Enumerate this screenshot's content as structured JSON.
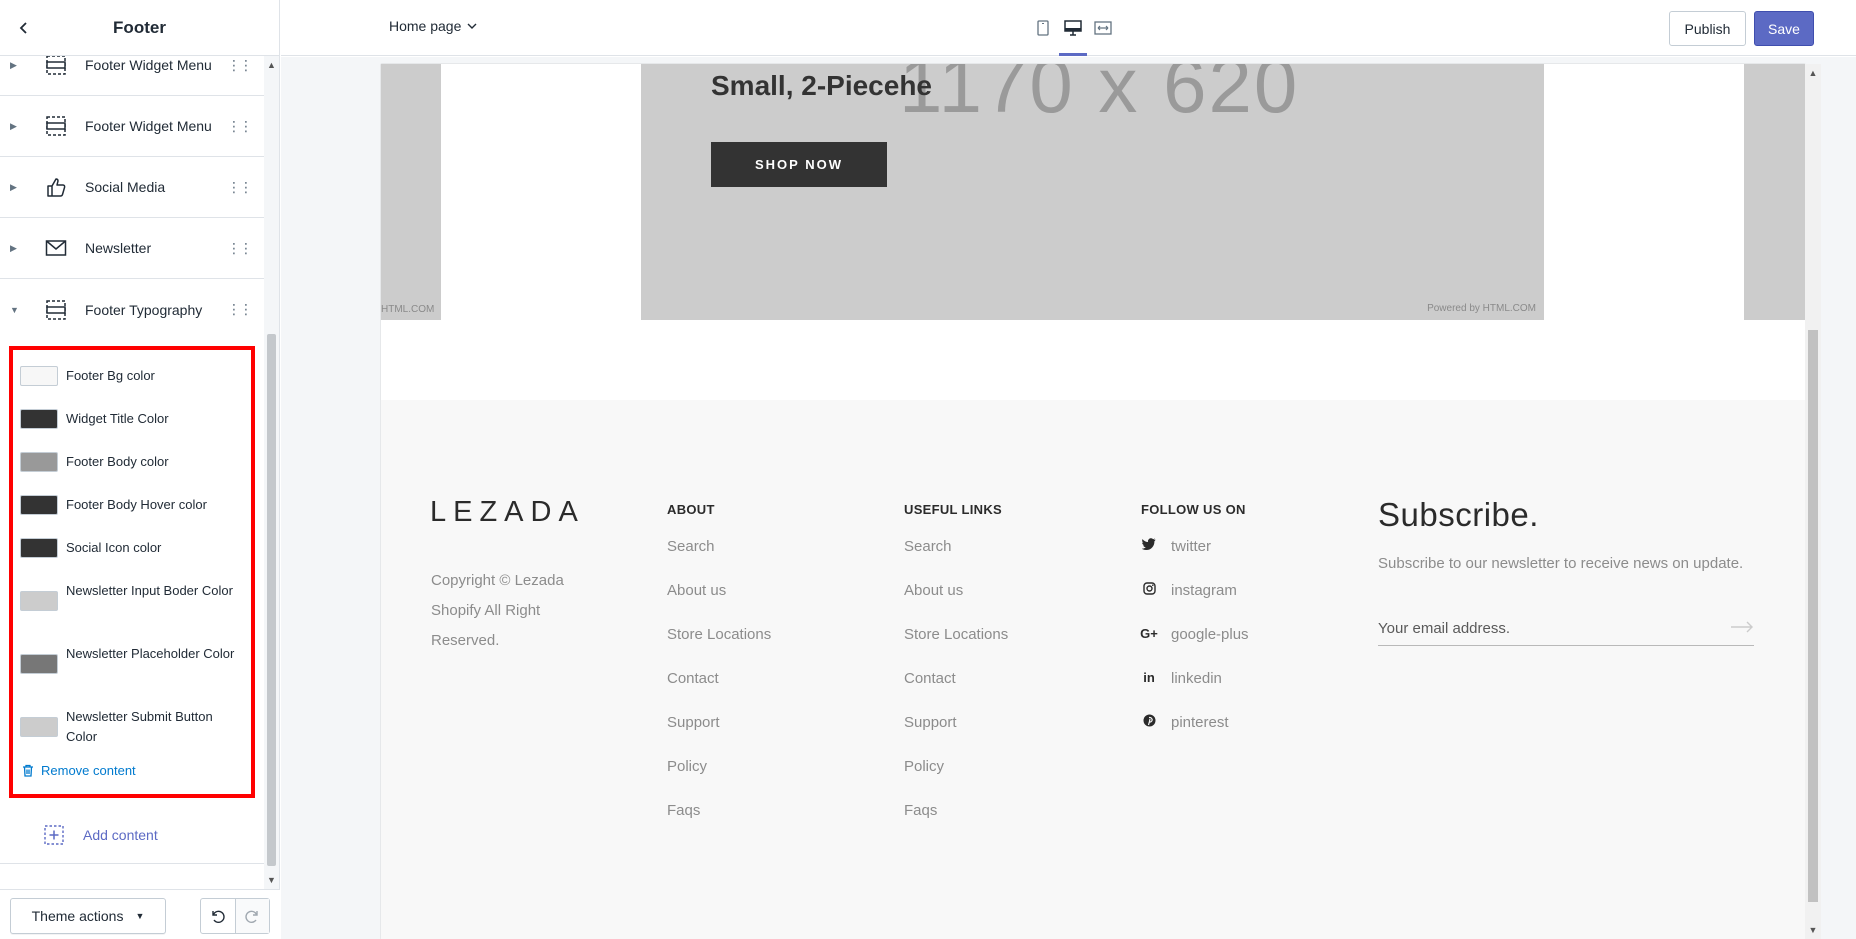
{
  "sidebar": {
    "title": "Footer",
    "sections": [
      {
        "label": "Footer Widget Menu",
        "icon": "widget-menu-icon"
      },
      {
        "label": "Footer Widget Menu",
        "icon": "widget-menu-icon"
      },
      {
        "label": "Social Media",
        "icon": "thumbs-up-icon"
      },
      {
        "label": "Newsletter",
        "icon": "envelope-icon"
      },
      {
        "label": "Footer Typography",
        "icon": "widget-menu-icon",
        "expanded": true
      }
    ],
    "color_settings": [
      {
        "label": "Footer Bg color",
        "color": "#f7f7f7"
      },
      {
        "label": "Widget Title Color",
        "color": "#333333"
      },
      {
        "label": "Footer Body color",
        "color": "#999999"
      },
      {
        "label": "Footer Body Hover color",
        "color": "#333333"
      },
      {
        "label": "Social Icon color",
        "color": "#333333"
      },
      {
        "label": "Newsletter Input Boder Color",
        "color": "#cccccc"
      },
      {
        "label": "Newsletter Placeholder Color",
        "color": "#777777"
      },
      {
        "label": "Newsletter Submit Button Color",
        "color": "#cccccc"
      }
    ],
    "remove_label": "Remove content",
    "add_label": "Add content",
    "theme_actions_label": "Theme actions"
  },
  "topbar": {
    "page_selector": "Home page",
    "publish_label": "Publish",
    "save_label": "Save",
    "accent": "#5c6ac4"
  },
  "preview": {
    "hero": {
      "heading": "Small, 2-Piecehe",
      "placeholder_size": "1170 x 620",
      "button": "SHOP NOW",
      "powered": "Powered by HTML.COM",
      "powered_left": "HTML.COM"
    },
    "footer": {
      "logo": "LEZADA",
      "copyright": "Copyright © Lezada Shopify All Right Reserved.",
      "about": {
        "heading": "ABOUT",
        "links": [
          "Search",
          "About us",
          "Store Locations",
          "Contact",
          "Support",
          "Policy",
          "Faqs"
        ]
      },
      "useful": {
        "heading": "USEFUL LINKS",
        "links": [
          "Search",
          "About us",
          "Store Locations",
          "Contact",
          "Support",
          "Policy",
          "Faqs"
        ]
      },
      "follow": {
        "heading": "FOLLOW US ON",
        "links": [
          {
            "label": "twitter",
            "icon": "twitter-icon"
          },
          {
            "label": "instagram",
            "icon": "instagram-icon"
          },
          {
            "label": "google-plus",
            "icon": "google-plus-icon"
          },
          {
            "label": "linkedin",
            "icon": "linkedin-icon"
          },
          {
            "label": "pinterest",
            "icon": "pinterest-icon"
          }
        ]
      },
      "subscribe": {
        "title": "Subscribe.",
        "description": "Subscribe to our newsletter to receive news on update.",
        "placeholder": "Your email address."
      }
    }
  }
}
